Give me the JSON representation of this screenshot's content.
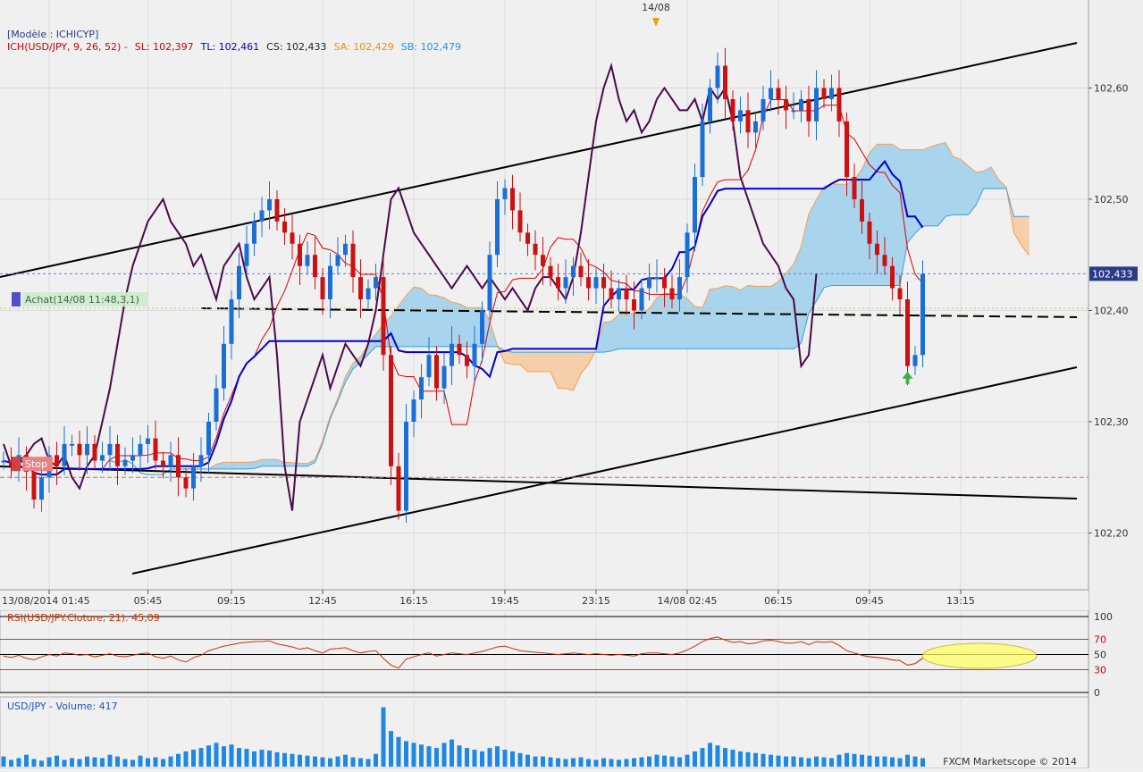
{
  "header": {
    "model_label": "[Modèle : ICHICYP]",
    "date_marker": "14/08",
    "ichimoku_legend": [
      {
        "text": "ICH(USD/JPY, 9, 26, 52) -",
        "color": "#cc0000"
      },
      {
        "text": "SL: 102,397",
        "color": "#cc0000"
      },
      {
        "text": "TL: 102,461",
        "color": "#0000cc"
      },
      {
        "text": "CS: 102,433",
        "color": "#222222"
      },
      {
        "text": "SA: 102,429",
        "color": "#ff8800"
      },
      {
        "text": "SB: 102,479",
        "color": "#1e90ff"
      }
    ]
  },
  "colors": {
    "up": "#1a6fd6",
    "down": "#cc1111",
    "tenkan": "#dd0000",
    "kijun": "#0000cc",
    "chikou": "#4b0a4b",
    "span_a": "#f5a050",
    "span_b": "#3aa0e0",
    "cloud_bull": "#a8d4ee",
    "cloud_bear": "#f5cfaa",
    "trend": "#000000",
    "volume": "#1e88e5",
    "rsi": "#cc3300"
  },
  "annotations": {
    "achat_label": "Achat(14/08 11:48,3,1)",
    "stop_label": "Stop",
    "current_price": "102,433",
    "entry_price": 102.402,
    "stop_price": 102.25,
    "watermark": "FXCM Marketscope © 2014"
  },
  "rsi_panel": {
    "label": "RSI(USD/JPY.Cloture, 21): 45,09",
    "levels": [
      "100",
      "70",
      "50",
      "30",
      "0"
    ],
    "level_values": [
      100,
      70,
      50,
      30,
      0
    ],
    "highlight_zone": "yellow ellipse over last RSI readings"
  },
  "volume_panel": {
    "label": "USD/JPY - Volume: 417"
  },
  "chart_data": {
    "type": "candlestick",
    "symbol": "USD/JPY",
    "y_ticks": [
      "102,60",
      "102,50",
      "102,40",
      "102,30",
      "102,20"
    ],
    "y_tick_values": [
      102.6,
      102.5,
      102.4,
      102.3,
      102.2
    ],
    "ylim": [
      102.157,
      102.655
    ],
    "x_ticks": [
      "13/08/2014 01:45",
      "05:45",
      "09:15",
      "12:45",
      "16:15",
      "19:45",
      "23:15",
      "14/08 02:45",
      "06:15",
      "09:45",
      "13:15"
    ],
    "x_tick_bars": [
      6,
      19,
      30,
      42,
      54,
      66,
      78,
      90,
      102,
      114,
      126
    ],
    "bar_count": 122,
    "closes": [
      102.265,
      102.26,
      102.27,
      102.255,
      102.23,
      102.25,
      102.27,
      102.26,
      102.28,
      102.28,
      102.27,
      102.28,
      102.265,
      102.27,
      102.28,
      102.26,
      102.265,
      102.27,
      102.28,
      102.285,
      102.265,
      102.26,
      102.27,
      102.25,
      102.24,
      102.26,
      102.27,
      102.3,
      102.33,
      102.37,
      102.41,
      102.44,
      102.46,
      102.48,
      102.49,
      102.5,
      102.48,
      102.47,
      102.46,
      102.44,
      102.45,
      102.43,
      102.41,
      102.44,
      102.45,
      102.46,
      102.43,
      102.41,
      102.42,
      102.43,
      102.36,
      102.26,
      102.22,
      102.3,
      102.32,
      102.34,
      102.36,
      102.33,
      102.35,
      102.37,
      102.36,
      102.35,
      102.37,
      102.4,
      102.45,
      102.5,
      102.51,
      102.49,
      102.47,
      102.46,
      102.45,
      102.44,
      102.43,
      102.42,
      102.43,
      102.44,
      102.43,
      102.42,
      102.43,
      102.42,
      102.41,
      102.42,
      102.41,
      102.4,
      102.42,
      102.43,
      102.43,
      102.42,
      102.41,
      102.43,
      102.47,
      102.52,
      102.57,
      102.6,
      102.62,
      102.59,
      102.57,
      102.58,
      102.56,
      102.57,
      102.59,
      102.6,
      102.59,
      102.58,
      102.58,
      102.59,
      102.57,
      102.6,
      102.59,
      102.6,
      102.57,
      102.52,
      102.5,
      102.48,
      102.46,
      102.45,
      102.44,
      102.42,
      102.41,
      102.35,
      102.36,
      102.433
    ],
    "rsi": [
      48,
      46,
      49,
      45,
      43,
      47,
      50,
      48,
      52,
      51,
      49,
      50,
      47,
      49,
      51,
      48,
      47,
      49,
      51,
      52,
      47,
      45,
      48,
      43,
      40,
      46,
      49,
      55,
      58,
      61,
      63,
      65,
      66,
      67,
      67,
      68,
      64,
      62,
      60,
      57,
      59,
      55,
      52,
      57,
      58,
      59,
      55,
      52,
      54,
      55,
      45,
      36,
      32,
      44,
      47,
      50,
      52,
      48,
      50,
      52,
      51,
      50,
      52,
      54,
      57,
      60,
      61,
      58,
      55,
      54,
      53,
      52,
      51,
      50,
      51,
      52,
      51,
      50,
      51,
      50,
      49,
      50,
      49,
      48,
      51,
      52,
      52,
      51,
      50,
      52,
      56,
      61,
      67,
      71,
      73,
      69,
      66,
      67,
      64,
      65,
      68,
      69,
      67,
      65,
      65,
      67,
      63,
      67,
      66,
      67,
      62,
      55,
      52,
      49,
      47,
      46,
      45,
      43,
      42,
      36,
      38,
      45.09
    ],
    "volume": [
      12,
      8,
      10,
      14,
      9,
      7,
      11,
      13,
      8,
      10,
      9,
      12,
      11,
      10,
      14,
      12,
      9,
      8,
      13,
      10,
      11,
      9,
      12,
      15,
      18,
      20,
      22,
      25,
      28,
      24,
      26,
      22,
      21,
      18,
      20,
      19,
      17,
      16,
      15,
      14,
      13,
      12,
      11,
      10,
      12,
      14,
      11,
      10,
      9,
      15,
      70,
      42,
      35,
      30,
      28,
      26,
      24,
      22,
      28,
      32,
      25,
      22,
      20,
      18,
      22,
      24,
      20,
      18,
      16,
      14,
      12,
      12,
      11,
      10,
      9,
      10,
      11,
      9,
      8,
      10,
      9,
      8,
      9,
      10,
      11,
      12,
      14,
      13,
      12,
      11,
      14,
      18,
      22,
      28,
      25,
      22,
      20,
      18,
      17,
      16,
      15,
      14,
      13,
      12,
      12,
      11,
      10,
      12,
      11,
      10,
      14,
      16,
      15,
      14,
      13,
      12,
      12,
      11,
      10,
      14,
      12,
      10
    ]
  }
}
